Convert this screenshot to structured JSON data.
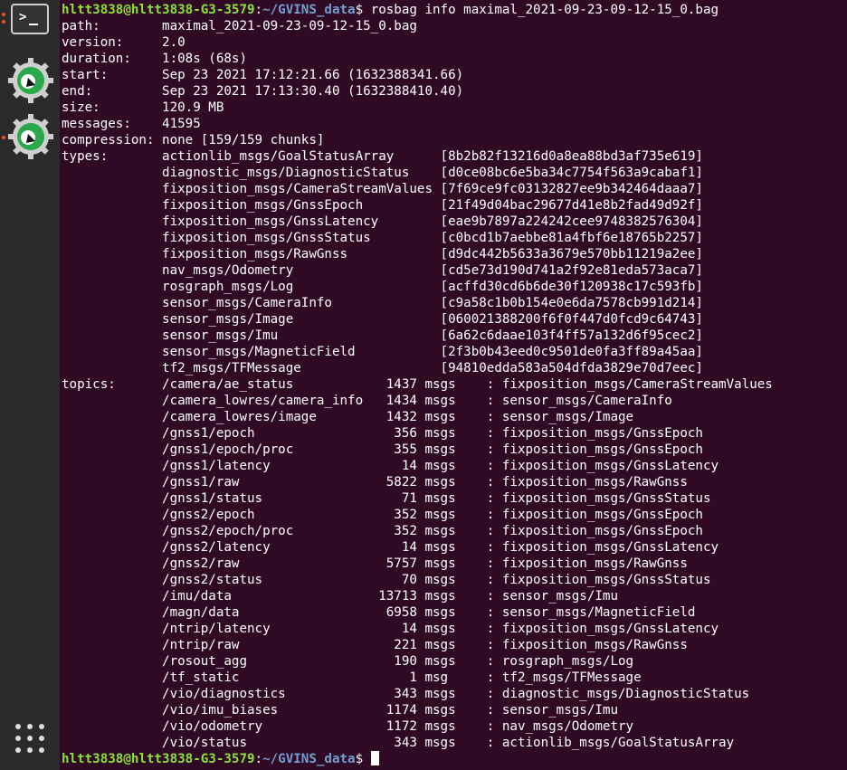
{
  "dock": {
    "items": [
      {
        "name": "terminal",
        "glyph": ">_"
      },
      {
        "name": "app-green-gear-1"
      },
      {
        "name": "app-green-gear-2"
      },
      {
        "name": "show-applications"
      }
    ]
  },
  "prompt": {
    "user_host": "hltt3838@hltt3838-G3-3579",
    "colon": ":",
    "path": "~/GVINS_data",
    "symbol": "$ ",
    "command": "rosbag info maximal_2021-09-23-09-12-15_0.bag"
  },
  "info": [
    "path:        maximal_2021-09-23-09-12-15_0.bag",
    "version:     2.0",
    "duration:    1:08s (68s)",
    "start:       Sep 23 2021 17:12:21.66 (1632388341.66)",
    "end:         Sep 23 2021 17:13:30.40 (1632388410.40)",
    "size:        120.9 MB",
    "messages:    41595",
    "compression: none [159/159 chunks]"
  ],
  "types": [
    "types:       actionlib_msgs/GoalStatusArray      [8b2b82f13216d0a8ea88bd3af735e619]",
    "             diagnostic_msgs/DiagnosticStatus    [d0ce08bc6e5ba34c7754f563a9cabaf1]",
    "             fixposition_msgs/CameraStreamValues [7f69ce9fc03132827ee9b342464daaa7]",
    "             fixposition_msgs/GnssEpoch          [21f49d04bac29677d41e8b2fad49d92f]",
    "             fixposition_msgs/GnssLatency        [eae9b7897a224242cee9748382576304]",
    "             fixposition_msgs/GnssStatus         [c0bcd1b7aebbe81a4fbf6e18765b2257]",
    "             fixposition_msgs/RawGnss            [d9dc442b5633a3679e570bb11219a2ee]",
    "             nav_msgs/Odometry                   [cd5e73d190d741a2f92e81eda573aca7]",
    "             rosgraph_msgs/Log                   [acffd30cd6b6de30f120938c17c593fb]",
    "             sensor_msgs/CameraInfo              [c9a58c1b0b154e0e6da7578cb991d214]",
    "             sensor_msgs/Image                   [060021388200f6f0f447d0fcd9c64743]",
    "             sensor_msgs/Imu                     [6a62c6daae103f4ff57a132d6f95cec2]",
    "             sensor_msgs/MagneticField           [2f3b0b43eed0c9501de0fa3ff89a45aa]",
    "             tf2_msgs/TFMessage                  [94810edda583a504dfda3829e70d7eec]"
  ],
  "topics": [
    "topics:      /camera/ae_status            1437 msgs    : fixposition_msgs/CameraStreamValues",
    "             /camera_lowres/camera_info   1434 msgs    : sensor_msgs/CameraInfo",
    "             /camera_lowres/image         1432 msgs    : sensor_msgs/Image",
    "             /gnss1/epoch                  356 msgs    : fixposition_msgs/GnssEpoch",
    "             /gnss1/epoch/proc             355 msgs    : fixposition_msgs/GnssEpoch",
    "             /gnss1/latency                 14 msgs    : fixposition_msgs/GnssLatency",
    "             /gnss1/raw                   5822 msgs    : fixposition_msgs/RawGnss",
    "             /gnss1/status                  71 msgs    : fixposition_msgs/GnssStatus",
    "             /gnss2/epoch                  352 msgs    : fixposition_msgs/GnssEpoch",
    "             /gnss2/epoch/proc             352 msgs    : fixposition_msgs/GnssEpoch",
    "             /gnss2/latency                 14 msgs    : fixposition_msgs/GnssLatency",
    "             /gnss2/raw                   5757 msgs    : fixposition_msgs/RawGnss",
    "             /gnss2/status                  70 msgs    : fixposition_msgs/GnssStatus",
    "             /imu/data                   13713 msgs    : sensor_msgs/Imu",
    "             /magn/data                   6958 msgs    : sensor_msgs/MagneticField",
    "             /ntrip/latency                 14 msgs    : fixposition_msgs/GnssLatency",
    "             /ntrip/raw                    221 msgs    : fixposition_msgs/RawGnss",
    "             /rosout_agg                   190 msgs    : rosgraph_msgs/Log",
    "             /tf_static                      1 msg     : tf2_msgs/TFMessage",
    "             /vio/diagnostics              343 msgs    : diagnostic_msgs/DiagnosticStatus",
    "             /vio/imu_biases              1174 msgs    : sensor_msgs/Imu",
    "             /vio/odometry                1172 msgs    : nav_msgs/Odometry",
    "             /vio/status                   343 msgs    : actionlib_msgs/GoalStatusArray"
  ],
  "final_prompt": {
    "user_host": "hltt3838@hltt3838-G3-3579",
    "colon": ":",
    "path": "~/GVINS_data",
    "symbol": "$ "
  },
  "colors": {
    "background": "#300a24",
    "dock": "#2b2b2b",
    "prompt_user": "#8ae234",
    "prompt_path": "#729fcf",
    "indicator": "#e95420"
  }
}
